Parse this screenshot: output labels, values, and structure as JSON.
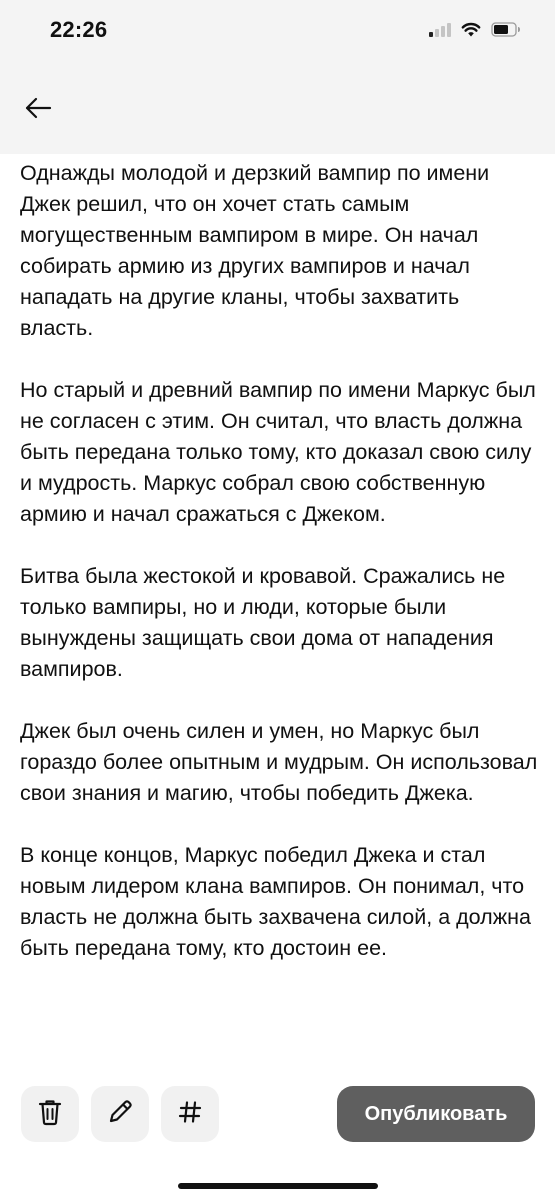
{
  "status_bar": {
    "time": "22:26",
    "signal_icon": "cellular-signal-icon",
    "wifi_icon": "wifi-icon",
    "battery_icon": "battery-icon"
  },
  "header": {
    "back_icon": "arrow-left-icon"
  },
  "article": {
    "paragraphs": [
      "Однажды молодой и дерзкий вампир по имени Джек решил, что он хочет стать самым могущественным вампиром в мире. Он начал собирать армию из других вампиров и начал нападать на другие кланы, чтобы захватить власть.",
      "Но старый и древний вампир по имени Маркус был не согласен с этим. Он считал, что власть должна быть передана только тому, кто доказал свою силу и мудрость. Маркус собрал свою собственную армию и начал сражаться с Джеком.",
      "Битва была жестокой и кровавой. Сражались не только вампиры, но и люди, которые были вынуждены защищать свои дома от нападения вампиров.",
      "Джек был очень силен и умен, но Маркус был гораздо более опытным и мудрым. Он использовал свои знания и магию, чтобы победить Джека.",
      "В конце концов, Маркус победил Джека и стал новым лидером клана вампиров. Он понимал, что власть не должна быть захвачена силой, а должна быть передана тому, кто достоин ее."
    ]
  },
  "toolbar": {
    "delete_icon": "trash-icon",
    "edit_icon": "pencil-icon",
    "hashtag_icon": "hashtag-icon",
    "publish_label": "Опубликовать"
  },
  "colors": {
    "top_background": "#f4f4f4",
    "publish_button": "#5f5f5f",
    "tool_button": "#f1f1f1"
  }
}
